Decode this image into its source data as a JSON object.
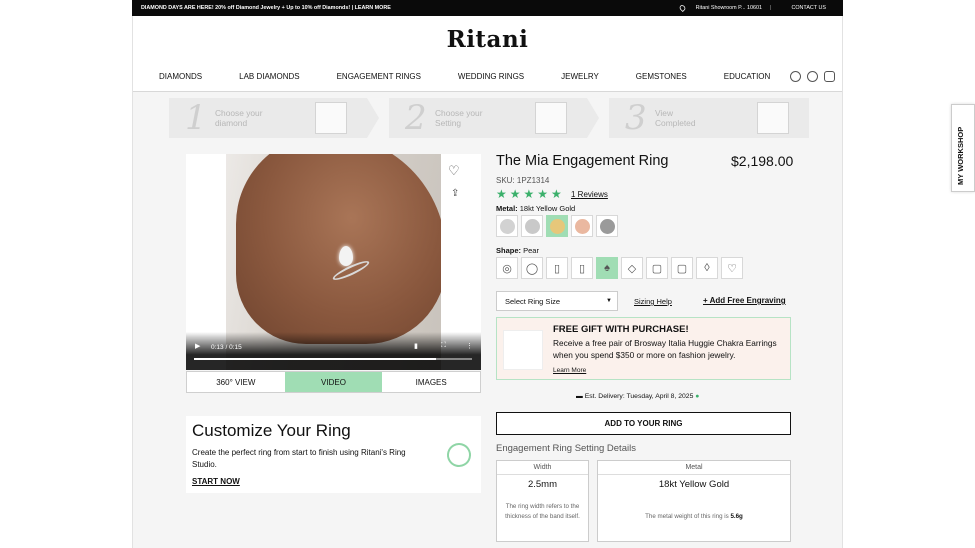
{
  "topbar": {
    "promo": "DIAMOND DAYS ARE HERE! 20% off Diamond Jewelry + Up to 10% off Diamonds! | LEARN MORE",
    "showroom": "Ritani Showroom P... 10601",
    "contact": "CONTACT US"
  },
  "header": {
    "logo": "Ritani",
    "nav": [
      "DIAMONDS",
      "LAB DIAMONDS",
      "ENGAGEMENT RINGS",
      "WEDDING RINGS",
      "JEWELRY",
      "GEMSTONES",
      "EDUCATION"
    ]
  },
  "steps": [
    {
      "num": "1",
      "line1": "Choose your",
      "line2": "diamond"
    },
    {
      "num": "2",
      "line1": "Choose your",
      "line2": "Setting"
    },
    {
      "num": "3",
      "line1": "View",
      "line2": "Completed"
    }
  ],
  "video": {
    "time": "0:13 / 0:15",
    "progress": 0.87
  },
  "media_tabs": [
    "360° VIEW",
    "VIDEO",
    "IMAGES"
  ],
  "customize": {
    "title": "Customize Your Ring",
    "body": "Create the perfect ring from start to finish using Ritani's Ring Studio.",
    "cta": "START NOW"
  },
  "product": {
    "title": "The Mia Engagement Ring",
    "price": "$2,198.00",
    "sku": "SKU: 1PZ1314",
    "stars": "★★★★★",
    "reviews": "1 Reviews",
    "metal_label": "Metal:",
    "metal_value": "18kt Yellow Gold",
    "metal_colors": [
      "#d2d2d2",
      "#c9c9c9",
      "#e6c77a",
      "#eab8a0",
      "#9a9a9a"
    ],
    "shape_label": "Shape:",
    "shape_value": "Pear",
    "shapes": [
      "◎",
      "◯",
      "▯",
      "▯",
      "♠",
      "◇",
      "▢",
      "▢",
      "◊",
      "♡"
    ],
    "ring_size": "Select Ring Size",
    "sizing_help": "Sizing Help",
    "engraving": "+ Add Free Engraving"
  },
  "gift": {
    "title": "FREE GIFT WITH PURCHASE!",
    "body": "Receive a free pair of Brosway Italia Huggie Chakra Earrings when you spend $350 or more on fashion jewelry.",
    "link": "Learn More"
  },
  "delivery": "Est. Delivery: Tuesday, April 8, 2025",
  "add_button": "ADD TO YOUR RING",
  "details": {
    "heading": "Engagement Ring Setting Details",
    "width": {
      "label": "Width",
      "value": "2.5mm",
      "note": "The ring width refers to the thickness of the band itself."
    },
    "metal": {
      "label": "Metal",
      "value": "18kt Yellow Gold",
      "note": "The metal weight of this ring is",
      "weight": "5.6g"
    }
  },
  "workshop": "MY WORKSHOP",
  "colors": {
    "accent": "#a0ddb4",
    "star": "#3bb06b"
  }
}
